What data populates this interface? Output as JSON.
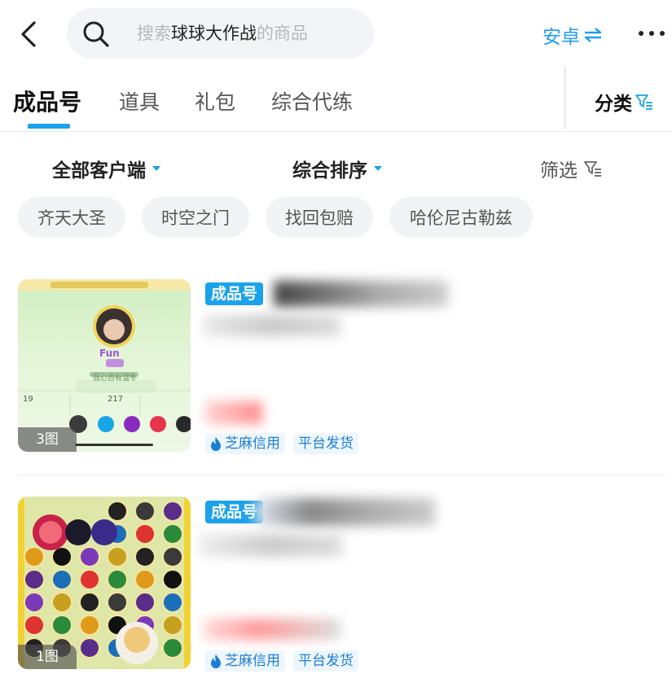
{
  "header": {
    "search_prefix": "搜索",
    "search_keyword": "球球大作战",
    "search_suffix": "的商品",
    "platform_label": "安卓"
  },
  "tabs": [
    {
      "label": "成品号",
      "active": true
    },
    {
      "label": "道具",
      "active": false
    },
    {
      "label": "礼包",
      "active": false
    },
    {
      "label": "综合代练",
      "active": false
    }
  ],
  "classify_label": "分类",
  "filters": {
    "client": "全部客户端",
    "sort": "综合排序",
    "screen": "筛选"
  },
  "chips": [
    "齐天大圣",
    "时空之门",
    "找回包赔",
    "哈伦尼古勒兹"
  ],
  "listings": [
    {
      "badge": "成品号",
      "image_count": "3图",
      "tags": [
        "芝麻信用",
        "平台发货"
      ]
    },
    {
      "badge": "成品号",
      "image_count": "1图",
      "tags": [
        "芝麻信用",
        "平台发货"
      ]
    }
  ],
  "thumb1": {
    "nickname": "Fun",
    "bio": "我心自有温冬",
    "stat1": "19",
    "stat2": "217"
  },
  "colors": {
    "accent": "#1aa2ea",
    "tag_bg": "#eef6fd",
    "chip_bg": "#f2f3f5"
  }
}
